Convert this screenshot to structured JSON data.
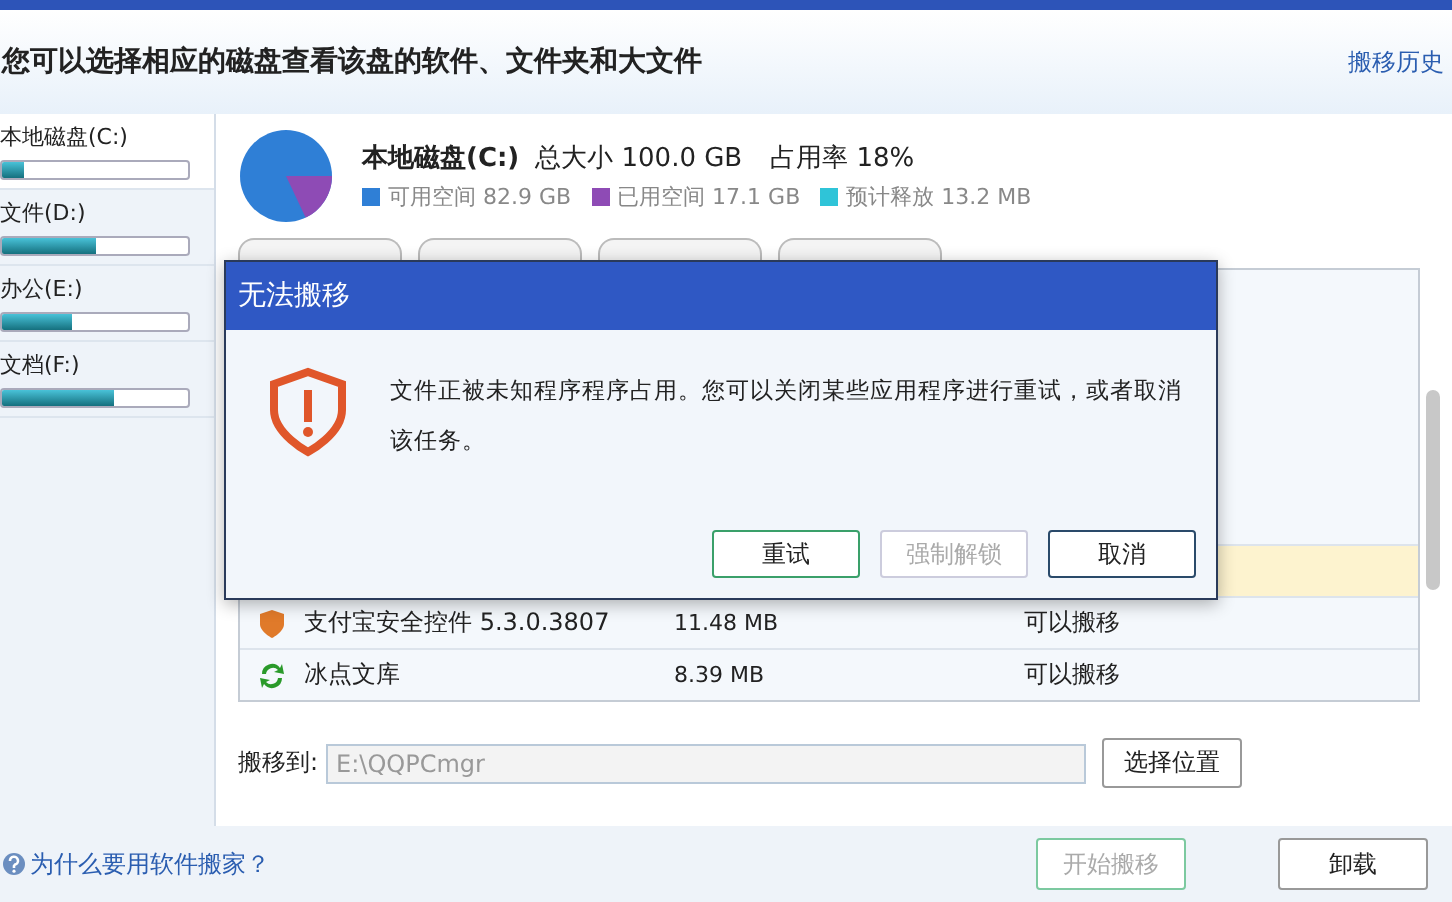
{
  "header": {
    "title": "您可以选择相应的磁盘查看该盘的软件、文件夹和大文件",
    "history_link": "搬移历史"
  },
  "drives": [
    {
      "label": "本地磁盘(C:)",
      "level": 0.12,
      "selected": true
    },
    {
      "label": "文件(D:)",
      "level": 0.5,
      "selected": false
    },
    {
      "label": "办公(E:)",
      "level": 0.38,
      "selected": false
    },
    {
      "label": "文档(F:)",
      "level": 0.6,
      "selected": false
    }
  ],
  "disk": {
    "name": "本地磁盘(C:)",
    "total": "总大小 100.0 GB",
    "usage": "占用率 18%",
    "legend": [
      {
        "label": "可用空间 82.9 GB",
        "color": "#2f7fd6"
      },
      {
        "label": "已用空间 17.1 GB",
        "color": "#8e4bb5"
      },
      {
        "label": "预计释放 13.2 MB",
        "color": "#2fc4d8"
      }
    ]
  },
  "table": {
    "rows": [
      {
        "selected": true
      },
      {
        "kind": "shield",
        "name": "支付宝安全控件 5.3.0.3807",
        "size": "11.48 MB",
        "status": "可以搬移",
        "selected": false
      },
      {
        "kind": "refresh",
        "name": "冰点文库",
        "size": "8.39 MB",
        "status": "可以搬移",
        "selected": false
      }
    ]
  },
  "move_to": {
    "label": "搬移到:",
    "value": "E:\\QQPCmgr",
    "button": "选择位置"
  },
  "footer": {
    "help": "为什么要用软件搬家？",
    "buttons": [
      {
        "label": "开始搬移",
        "disabled": true
      },
      {
        "label": "卸载",
        "disabled": false
      }
    ]
  },
  "dialog": {
    "title": "无法搬移",
    "message": "文件正被未知程序程序占用。您可以关闭某些应用程序进行重试，或者取消该任务。",
    "buttons": [
      {
        "label": "重试",
        "disabled": false,
        "default": true
      },
      {
        "label": "强制解锁",
        "disabled": true,
        "default": false
      },
      {
        "label": "取消",
        "disabled": false,
        "default": false
      }
    ]
  }
}
